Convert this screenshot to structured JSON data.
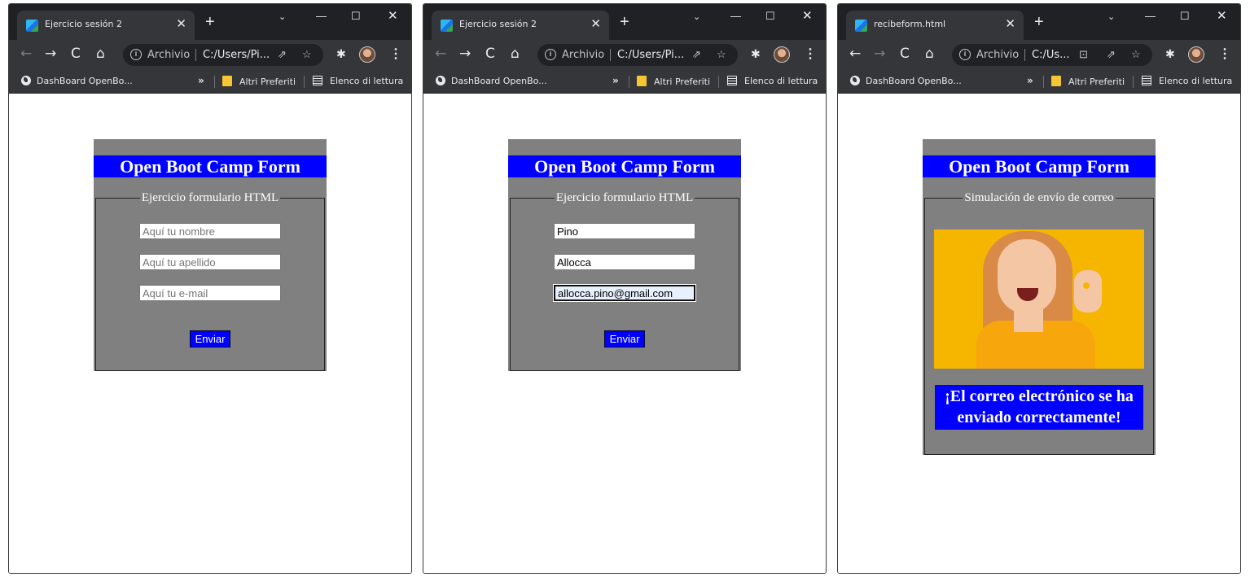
{
  "browser": {
    "new_tab_symbol": "+",
    "close_symbol": "✕",
    "controls": {
      "chevron": "⌄",
      "minimize": "—",
      "maximize": "☐",
      "close": "✕"
    },
    "nav": {
      "back": "←",
      "forward": "→",
      "reload": "C",
      "home": "⌂"
    },
    "archivio_label": "Archivio",
    "bookmarks": {
      "dashboard": "DashBoard OpenBo...",
      "more": "»",
      "altri": "Altri Preferiti",
      "elenco": "Elenco di lettura"
    },
    "icons": {
      "info": "i",
      "share": "⇗",
      "star": "☆",
      "extensions": "✱",
      "menu": "⋮",
      "translate": "⊡"
    }
  },
  "windows": [
    {
      "tab_title": "Ejercicio sesión 2",
      "url": "C:/Users/Pi...",
      "form": {
        "title": "Open Boot Camp Form",
        "legend": "Ejercicio formulario HTML",
        "nombre": {
          "placeholder": "Aquí tu nombre",
          "value": ""
        },
        "apellido": {
          "placeholder": "Aquí tu apellido",
          "value": ""
        },
        "email": {
          "placeholder": "Aquí tu e-mail",
          "value": ""
        },
        "submit_label": "Enviar"
      }
    },
    {
      "tab_title": "Ejercicio sesión 2",
      "url": "C:/Users/Pi...",
      "form": {
        "title": "Open Boot Camp Form",
        "legend": "Ejercicio formulario HTML",
        "nombre": {
          "placeholder": "Aquí tu nombre",
          "value": "Pino"
        },
        "apellido": {
          "placeholder": "Aquí tu apellido",
          "value": "Allocca"
        },
        "email": {
          "placeholder": "Aquí tu e-mail",
          "value": "allocca.pino@gmail.com"
        },
        "submit_label": "Enviar"
      }
    },
    {
      "tab_title": "recibeform.html",
      "url": "C:/Us...",
      "result": {
        "title": "Open Boot Camp Form",
        "legend": "Simulación de envío de correo",
        "message": "¡El correo electrónico se ha enviado correctamente!"
      }
    }
  ],
  "colors": {
    "title_bg": "#0000ff",
    "form_bg": "#808080",
    "chrome_dark": "#202124",
    "chrome_toolbar": "#35363a"
  }
}
